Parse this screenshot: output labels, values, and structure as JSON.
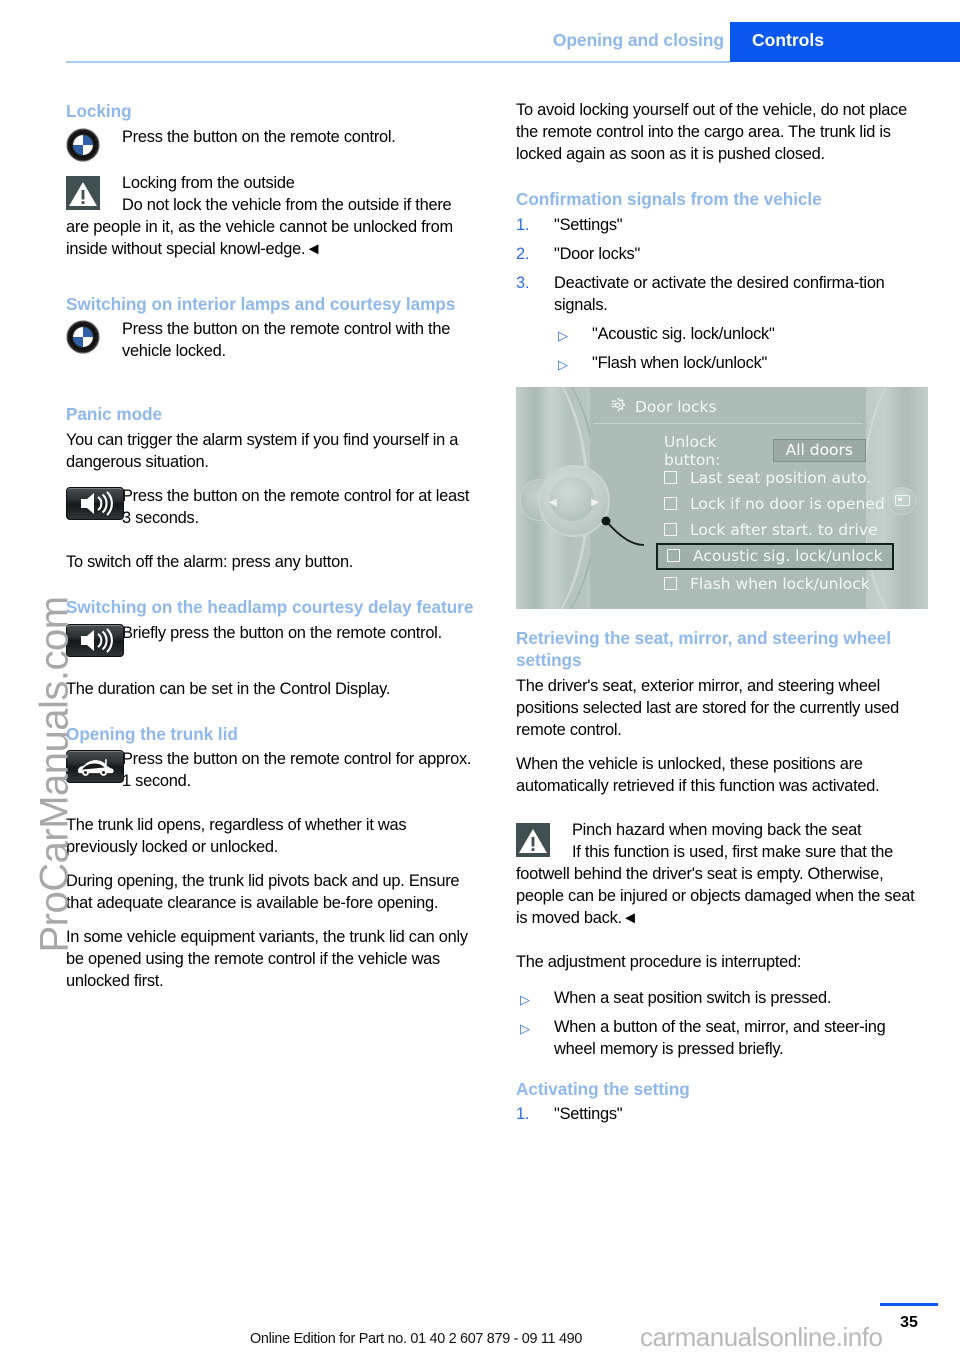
{
  "header": {
    "chapter": "Opening and closing",
    "section": "Controls"
  },
  "left_column": {
    "locking": {
      "heading": "Locking",
      "icon": "bmw-roundel-icon",
      "instruction": "Press the button on the remote control.",
      "warning": {
        "icon": "warning-triangle-icon",
        "title": "Locking from the outside",
        "body": "Do not lock the vehicle from the outside if there are people in it, as the vehicle cannot be unlocked from inside without special knowl-edge.◄"
      }
    },
    "interior_lamps": {
      "heading": "Switching on interior lamps and courtesy lamps",
      "icon": "bmw-roundel-icon",
      "instruction": "Press the button on the remote control with the vehicle locked."
    },
    "panic_mode": {
      "heading": "Panic mode",
      "intro": "You can trigger the alarm system if you find yourself in a dangerous situation.",
      "icon": "horn-speaker-button-icon",
      "instruction": "Press the button on the remote control for at least 3 seconds.",
      "note": "To switch off the alarm: press any button."
    },
    "headlamp_courtesy": {
      "heading": "Switching on the headlamp courtesy delay feature",
      "icon": "horn-speaker-button-icon",
      "instruction": "Briefly press the button on the remote control.",
      "note": "The duration can be set in the Control Display."
    },
    "trunk_lid": {
      "heading": "Opening the trunk lid",
      "icon": "trunk-open-button-icon",
      "instruction": "Press the button on the remote control for approx. 1 second.",
      "paragraphs": [
        "The trunk lid opens, regardless of whether it was previously locked or unlocked.",
        "During opening, the trunk lid pivots back and up. Ensure that adequate clearance is available be-fore opening.",
        "In some vehicle equipment variants, the trunk lid can only be opened using the remote control if the vehicle was unlocked first."
      ]
    }
  },
  "right_column": {
    "intro_paragraph": "To avoid locking yourself out of the vehicle, do not place the remote control into the cargo area. The trunk lid is locked again as soon as it is pushed closed.",
    "confirmation_signals": {
      "heading": "Confirmation signals from the vehicle",
      "steps": [
        {
          "num": "1.",
          "text": "\"Settings\""
        },
        {
          "num": "2.",
          "text": "\"Door locks\""
        },
        {
          "num": "3.",
          "text": "Deactivate or activate the desired confirma-tion signals."
        }
      ],
      "sub_items": [
        "\"Acoustic sig. lock/unlock\"",
        "\"Flash when lock/unlock\""
      ]
    },
    "idrive_display": {
      "gear_icon": "gear-settings-icon",
      "title": "Door locks",
      "unlock_label": "Unlock button:",
      "unlock_value": "All doors",
      "options": [
        {
          "label": "Last seat position auto.",
          "checked": false,
          "highlighted": false
        },
        {
          "label": "Lock if no door is opened",
          "checked": false,
          "highlighted": false
        },
        {
          "label": "Lock after start. to drive",
          "checked": false,
          "highlighted": false
        },
        {
          "label": "Acoustic sig. lock/unlock",
          "checked": false,
          "highlighted": true
        },
        {
          "label": "Flash when lock/unlock",
          "checked": false,
          "highlighted": false
        }
      ],
      "controller_icon": "idrive-controller-knob-icon",
      "side_button_icon": "idrive-menu-button-icon"
    },
    "retrieving_settings": {
      "heading": "Retrieving the seat, mirror, and steering wheel settings",
      "paragraphs": [
        "The driver's seat, exterior mirror, and steering wheel positions selected last are stored for the currently used remote control.",
        "When the vehicle is unlocked, these positions are automatically retrieved if this function was activated."
      ],
      "warning": {
        "icon": "warning-triangle-icon",
        "title": "Pinch hazard when moving back the seat",
        "body": "If this function is used, first make sure that the footwell behind the driver's seat is empty. Otherwise, people can be injured or objects damaged when the seat is moved back.◄"
      },
      "interrupt_intro": "The adjustment procedure is interrupted:",
      "interrupt_items": [
        "When a seat position switch is pressed.",
        "When a button of the seat, mirror, and steer-ing wheel memory is pressed briefly."
      ]
    },
    "activating_setting": {
      "heading": "Activating the setting",
      "steps": [
        {
          "num": "1.",
          "text": "\"Settings\""
        }
      ]
    }
  },
  "footer": {
    "edition_line": "Online Edition for Part no. 01 40 2 607 879 - 09 11 490",
    "page_number": "35"
  },
  "watermarks": {
    "left": "ProCarManuals.com",
    "bottom": "carmanualsonline.info"
  },
  "colors": {
    "accent_blue": "#0a58f0",
    "heading_blue": "#8fb8ec",
    "list_marker_blue": "#2b6fe0",
    "warning_icon_bg": "#404f4f",
    "display_bg": "#aebcb7"
  }
}
